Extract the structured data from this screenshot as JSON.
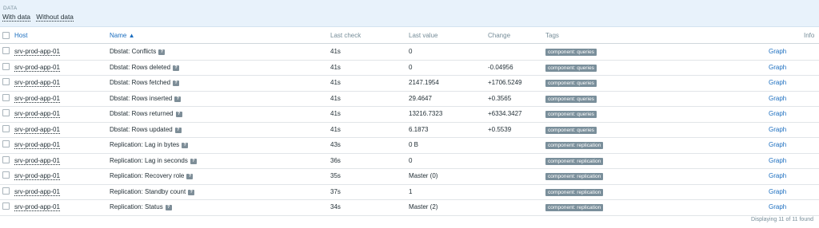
{
  "filter": {
    "title": "DATA",
    "tabs": [
      "With data",
      "Without data"
    ]
  },
  "header": {
    "host": "Host",
    "name": "Name ▲",
    "last_check": "Last check",
    "last_value": "Last value",
    "change": "Change",
    "tags": "Tags",
    "info": "Info"
  },
  "rows": [
    {
      "host": "srv-prod-app-01",
      "name": "Dbstat: Conflicts",
      "last_check": "41s",
      "last_value": "0",
      "change": "",
      "tag": "component: queries",
      "graph": "Graph"
    },
    {
      "host": "srv-prod-app-01",
      "name": "Dbstat: Rows deleted",
      "last_check": "41s",
      "last_value": "0",
      "change": "-0.04956",
      "tag": "component: queries",
      "graph": "Graph"
    },
    {
      "host": "srv-prod-app-01",
      "name": "Dbstat: Rows fetched",
      "last_check": "41s",
      "last_value": "2147.1954",
      "change": "+1706.5249",
      "tag": "component: queries",
      "graph": "Graph"
    },
    {
      "host": "srv-prod-app-01",
      "name": "Dbstat: Rows inserted",
      "last_check": "41s",
      "last_value": "29.4647",
      "change": "+0.3565",
      "tag": "component: queries",
      "graph": "Graph"
    },
    {
      "host": "srv-prod-app-01",
      "name": "Dbstat: Rows returned",
      "last_check": "41s",
      "last_value": "13216.7323",
      "change": "+6334.3427",
      "tag": "component: queries",
      "graph": "Graph"
    },
    {
      "host": "srv-prod-app-01",
      "name": "Dbstat: Rows updated",
      "last_check": "41s",
      "last_value": "6.1873",
      "change": "+0.5539",
      "tag": "component: queries",
      "graph": "Graph"
    },
    {
      "host": "srv-prod-app-01",
      "name": "Replication: Lag in bytes",
      "last_check": "43s",
      "last_value": "0 B",
      "change": "",
      "tag": "component: replication",
      "graph": "Graph"
    },
    {
      "host": "srv-prod-app-01",
      "name": "Replication: Lag in seconds",
      "last_check": "36s",
      "last_value": "0",
      "change": "",
      "tag": "component: replication",
      "graph": "Graph"
    },
    {
      "host": "srv-prod-app-01",
      "name": "Replication: Recovery role",
      "last_check": "35s",
      "last_value": "Master (0)",
      "change": "",
      "tag": "component: replication",
      "graph": "Graph"
    },
    {
      "host": "srv-prod-app-01",
      "name": "Replication: Standby count",
      "last_check": "37s",
      "last_value": "1",
      "change": "",
      "tag": "component: replication",
      "graph": "Graph"
    },
    {
      "host": "srv-prod-app-01",
      "name": "Replication: Status",
      "last_check": "34s",
      "last_value": "Master (2)",
      "change": "",
      "tag": "component: replication",
      "graph": "Graph"
    }
  ],
  "footer": "Displaying 11 of 11 found",
  "icons": {
    "description": "?"
  }
}
